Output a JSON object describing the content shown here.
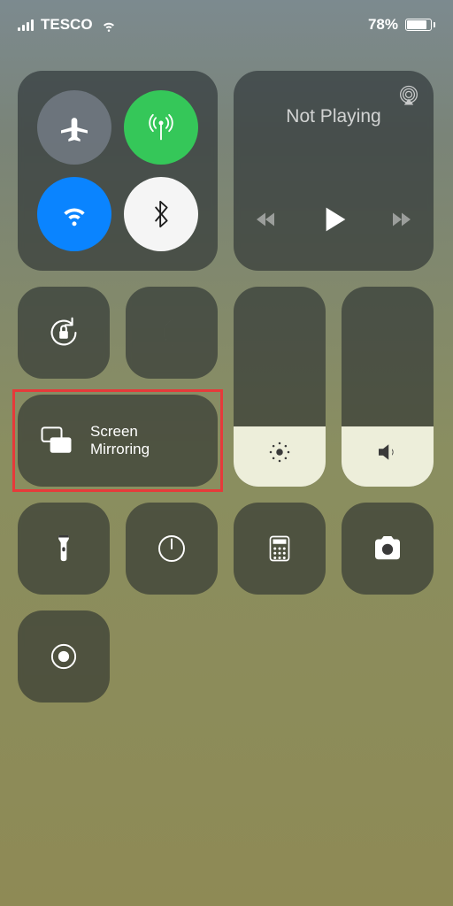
{
  "statusbar": {
    "carrier": "TESCO",
    "battery_percent": "78%"
  },
  "connectivity": {
    "airplane": {
      "active": false,
      "icon": "airplane-icon"
    },
    "cellular": {
      "active": true,
      "icon": "cellular-antenna-icon"
    },
    "wifi": {
      "active": true,
      "icon": "wifi-icon"
    },
    "bluetooth": {
      "active": true,
      "icon": "bluetooth-icon"
    }
  },
  "media": {
    "now_playing_label": "Not Playing",
    "has_prev": true,
    "has_next": true
  },
  "toggles": {
    "orientation_lock": "orientation-lock-icon",
    "do_not_disturb": "moon-icon"
  },
  "sliders": {
    "brightness": {
      "level": 0.3,
      "icon": "brightness-icon"
    },
    "volume": {
      "level": 0.3,
      "icon": "volume-icon"
    }
  },
  "screen_mirroring": {
    "label_line1": "Screen",
    "label_line2": "Mirroring"
  },
  "shortcuts": {
    "flashlight": "flashlight-icon",
    "timer": "timer-icon",
    "calculator": "calculator-icon",
    "camera": "camera-icon",
    "screen_record": "screen-record-icon"
  },
  "annotation": {
    "highlight_target": "screen-mirroring-tile",
    "color": "#e63a3a"
  }
}
